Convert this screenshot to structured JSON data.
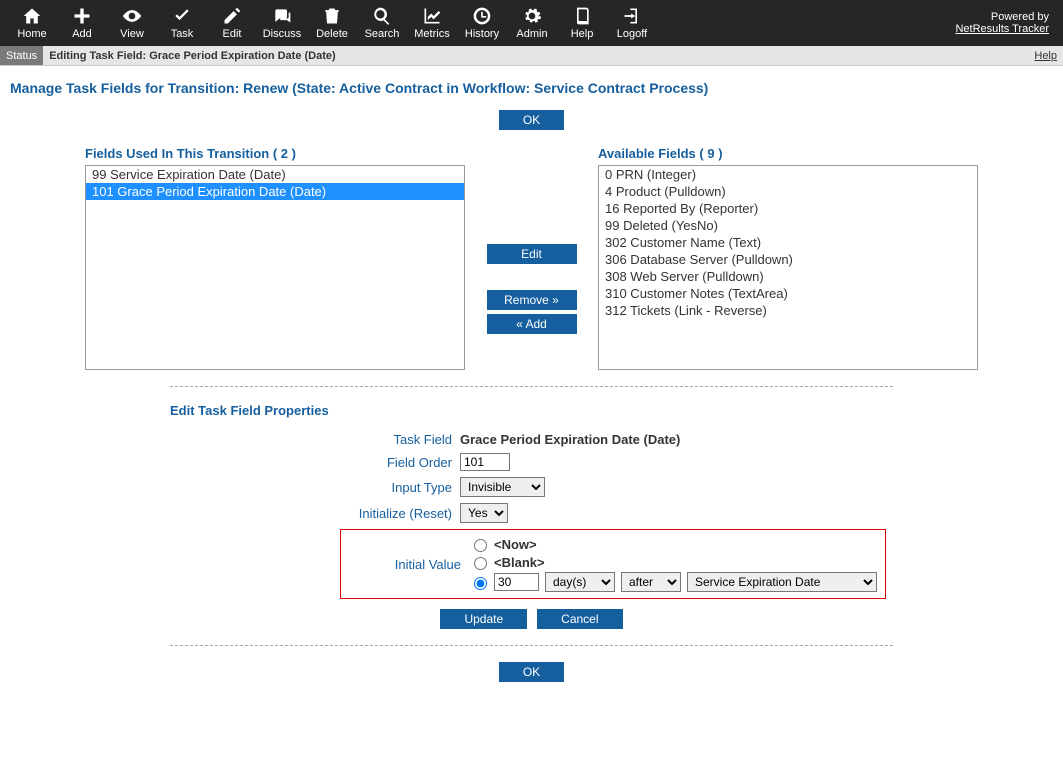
{
  "toolbar": {
    "items": [
      {
        "label": "Home"
      },
      {
        "label": "Add"
      },
      {
        "label": "View"
      },
      {
        "label": "Task"
      },
      {
        "label": "Edit"
      },
      {
        "label": "Discuss"
      },
      {
        "label": "Delete"
      },
      {
        "label": "Search"
      },
      {
        "label": "Metrics"
      },
      {
        "label": "History"
      },
      {
        "label": "Admin"
      },
      {
        "label": "Help"
      },
      {
        "label": "Logoff"
      }
    ],
    "powered_by": "Powered by",
    "product_link": "NetResults Tracker"
  },
  "statusbar": {
    "label": "Status",
    "text": "Editing Task Field: Grace Period Expiration Date (Date)",
    "help": "Help"
  },
  "page_title": "Manage Task Fields for Transition: Renew (State: Active Contract in Workflow: Service Contract Process)",
  "buttons": {
    "ok": "OK",
    "edit": "Edit",
    "remove": "Remove »",
    "add": "« Add",
    "update": "Update",
    "cancel": "Cancel"
  },
  "used_panel": {
    "title": "Fields Used In This Transition",
    "count": "( 2 )",
    "items": [
      {
        "text": "99  Service Expiration Date  (Date)",
        "selected": false
      },
      {
        "text": "101  Grace Period Expiration Date  (Date)",
        "selected": true
      }
    ]
  },
  "avail_panel": {
    "title": "Available Fields",
    "count": "( 9 )",
    "items": [
      {
        "text": "0  PRN  (Integer)"
      },
      {
        "text": "4  Product  (Pulldown)"
      },
      {
        "text": "16  Reported By  (Reporter)"
      },
      {
        "text": "99  Deleted  (YesNo)"
      },
      {
        "text": "302  Customer Name  (Text)"
      },
      {
        "text": "306  Database Server  (Pulldown)"
      },
      {
        "text": "308  Web Server  (Pulldown)"
      },
      {
        "text": "310  Customer Notes  (TextArea)"
      },
      {
        "text": "312  Tickets  (Link - Reverse)"
      }
    ]
  },
  "props": {
    "section_title": "Edit Task Field Properties",
    "task_field_label": "Task Field",
    "task_field_value": "Grace Period Expiration Date (Date)",
    "field_order_label": "Field Order",
    "field_order_value": "101",
    "input_type_label": "Input Type",
    "input_type_value": "Invisible",
    "initialize_label": "Initialize (Reset)",
    "initialize_value": "Yes",
    "initial_value_label": "Initial Value",
    "radio_now": "<Now>",
    "radio_blank": "<Blank>",
    "offset_value": "30",
    "unit_value": "day(s)",
    "relation_value": "after",
    "reference_value": "Service Expiration Date"
  }
}
